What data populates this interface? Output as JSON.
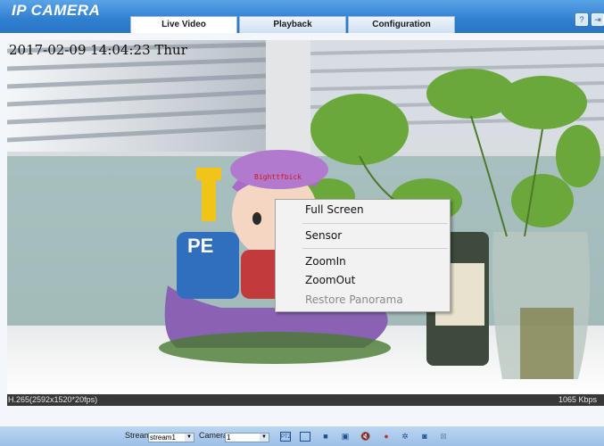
{
  "header": {
    "logo": "IP CAMERA",
    "tabs": [
      {
        "label": "Live Video",
        "active": true
      },
      {
        "label": "Playback",
        "active": false
      },
      {
        "label": "Configuration",
        "active": false
      }
    ],
    "icons": [
      "help-icon",
      "logout-icon"
    ]
  },
  "video": {
    "timestamp": "2017-02-09 14:04:23 Thur",
    "osd_label": "Bighttfbick"
  },
  "context_menu": {
    "items": [
      {
        "label": "Full Screen",
        "enabled": true
      },
      {
        "label": "Sensor",
        "enabled": true
      },
      {
        "label": "ZoomIn",
        "enabled": true
      },
      {
        "label": "ZoomOut",
        "enabled": true
      },
      {
        "label": "Restore Panorama",
        "enabled": false
      }
    ]
  },
  "status_bar": {
    "codec_info": "H.265(2592x1520*20fps)",
    "bitrate": "1065 Kbps"
  },
  "toolbar": {
    "stream_label": "Stream",
    "stream_value": "stream1",
    "camera_label": "Camera",
    "camera_value": "1",
    "icons": [
      "ptz-icon",
      "fit-screen-icon",
      "stop-icon",
      "record-icon",
      "mute-icon",
      "mic-icon",
      "settings-icon",
      "snapshot-icon",
      "crop-icon"
    ]
  },
  "colors": {
    "header_blue": "#2f7fd0",
    "toolbar_blue": "#a9c9ec",
    "status_bar": "#383838",
    "osd_red": "#d21818"
  }
}
